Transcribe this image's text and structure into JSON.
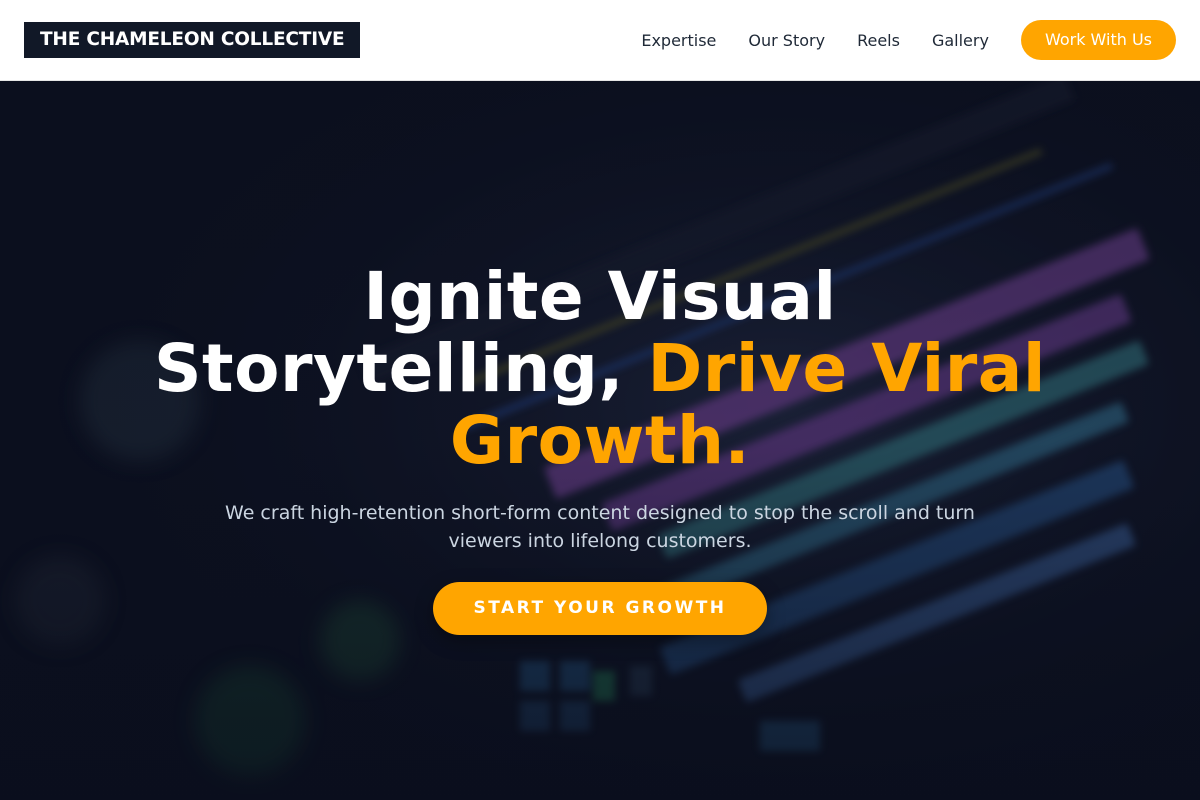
{
  "header": {
    "logo": "THE CHAMELEON COLLECTIVE",
    "nav": [
      "Expertise",
      "Our Story",
      "Reels",
      "Gallery"
    ],
    "cta": "Work With Us"
  },
  "hero": {
    "title_part1": "Ignite Visual Storytelling, ",
    "title_accent": "Drive Viral Growth.",
    "subtitle": "We craft high-retention short-form content designed to stop the scroll and turn viewers into lifelong customers.",
    "cta": "START YOUR GROWTH"
  },
  "colors": {
    "accent": "#ffa500",
    "logo_bg": "#111827",
    "hero_bg": "#0c1020"
  }
}
